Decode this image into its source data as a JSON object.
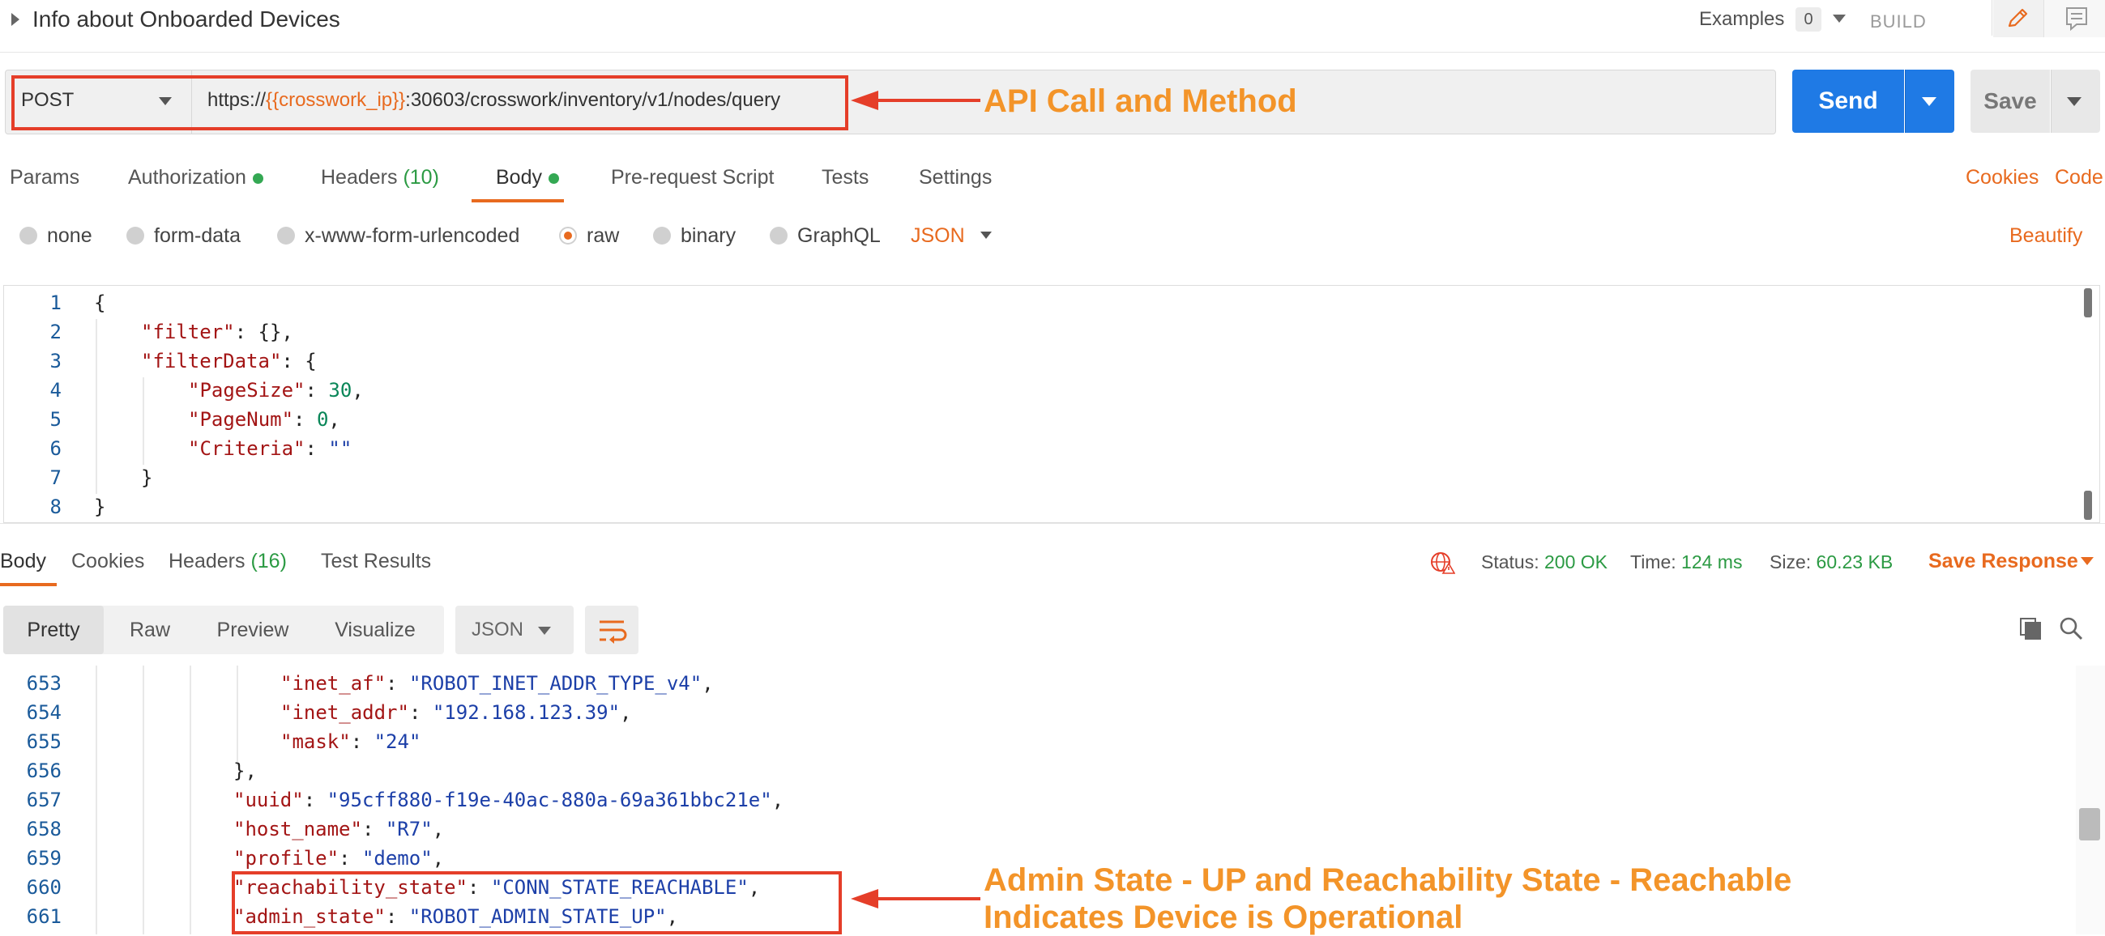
{
  "header": {
    "title": "Info about Onboarded Devices",
    "examples_label": "Examples",
    "examples_count": "0",
    "build_label": "BUILD"
  },
  "request": {
    "method": "POST",
    "url_prefix": "https://",
    "url_variable": "{{crosswork_ip}}",
    "url_suffix": ":30603/crosswork/inventory/v1/nodes/query",
    "send_label": "Send",
    "save_label": "Save"
  },
  "annotations": {
    "url_label": "API Call and Method",
    "resp_label_line1": "Admin State - UP and Reachability State - Reachable",
    "resp_label_line2": "Indicates Device is Operational"
  },
  "request_tabs": {
    "params": "Params",
    "authorization": "Authorization",
    "headers": "Headers",
    "headers_count": "(10)",
    "body": "Body",
    "prerequest": "Pre-request Script",
    "tests": "Tests",
    "settings": "Settings",
    "cookies": "Cookies",
    "code": "Code"
  },
  "body_types": {
    "none": "none",
    "form_data": "form-data",
    "urlencoded": "x-www-form-urlencoded",
    "raw": "raw",
    "binary": "binary",
    "graphql": "GraphQL",
    "format": "JSON",
    "beautify": "Beautify"
  },
  "request_body": {
    "line_numbers": [
      "1",
      "2",
      "3",
      "4",
      "5",
      "6",
      "7",
      "8"
    ],
    "open_brace": "{",
    "filter_key": "\"filter\"",
    "filter_val": ": {},",
    "filterdata_key": "\"filterData\"",
    "filterdata_val": ": {",
    "pagesize_key": "\"PageSize\"",
    "pagesize_val": "30",
    "pagenum_key": "\"PageNum\"",
    "pagenum_val": "0",
    "criteria_key": "\"Criteria\"",
    "criteria_val": "\"\"",
    "inner_close": "}",
    "close_brace": "}"
  },
  "response_tabs": {
    "body": "Body",
    "cookies": "Cookies",
    "headers": "Headers",
    "headers_count": "(16)",
    "test_results": "Test Results"
  },
  "response_meta": {
    "status_label": "Status:",
    "status_value": "200 OK",
    "time_label": "Time:",
    "time_value": "124 ms",
    "size_label": "Size:",
    "size_value": "60.23 KB",
    "save_response": "Save Response"
  },
  "response_toolbar": {
    "pretty": "Pretty",
    "raw": "Raw",
    "preview": "Preview",
    "visualize": "Visualize",
    "format": "JSON"
  },
  "response_body": {
    "line_numbers": [
      "653",
      "654",
      "655",
      "656",
      "657",
      "658",
      "659",
      "660",
      "661"
    ],
    "inet_af_key": "\"inet_af\"",
    "inet_af_val": "\"ROBOT_INET_ADDR_TYPE_v4\"",
    "inet_addr_key": "\"inet_addr\"",
    "inet_addr_val": "\"192.168.123.39\"",
    "mask_key": "\"mask\"",
    "mask_val": "\"24\"",
    "close_obj": "},",
    "uuid_key": "\"uuid\"",
    "uuid_val": "\"95cff880-f19e-40ac-880a-69a361bbc21e\"",
    "host_name_key": "\"host_name\"",
    "host_name_val": "\"R7\"",
    "profile_key": "\"profile\"",
    "profile_val": "\"demo\"",
    "reachability_key": "\"reachability_state\"",
    "reachability_val": "\"CONN_STATE_REACHABLE\"",
    "admin_key": "\"admin_state\"",
    "admin_val": "\"ROBOT_ADMIN_STATE_UP\""
  },
  "icons": {
    "edit": "pencil-icon",
    "comment": "comment-icon",
    "globe": "globe-icon",
    "wrap": "wrap-lines-icon",
    "copy": "copy-icon",
    "search": "search-icon"
  },
  "colors": {
    "accent": "#e86a1f",
    "send": "#1f7ae5",
    "annotation_box": "#e53e29",
    "annotation_text": "#f39429",
    "status_ok": "#2b9a43"
  }
}
